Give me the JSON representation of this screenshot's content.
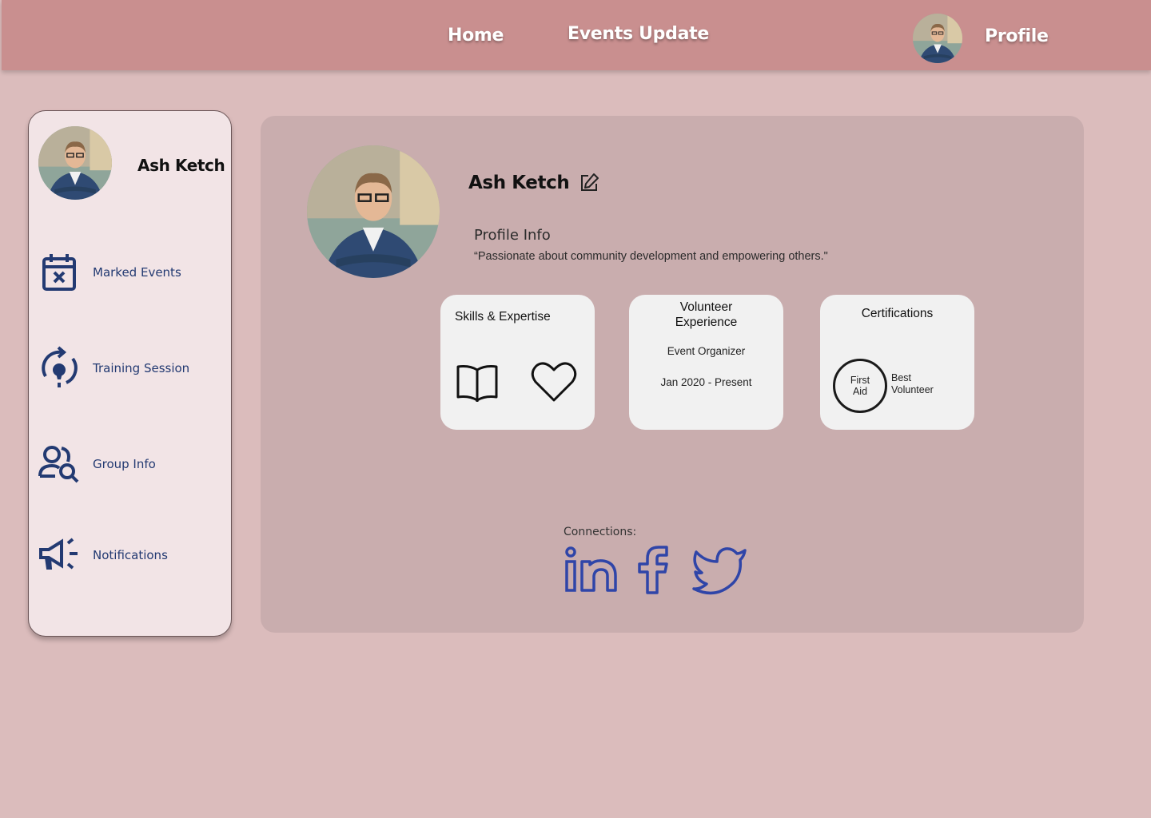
{
  "nav": {
    "home": "Home",
    "events_update": "Events Update",
    "profile": "Profile"
  },
  "user": {
    "name": "Ash Ketch"
  },
  "sidebar": {
    "items": [
      {
        "label": "Marked Events",
        "icon": "calendar-x-icon"
      },
      {
        "label": "Training Session",
        "icon": "lightbulb-refresh-icon"
      },
      {
        "label": "Group Info",
        "icon": "user-search-icon"
      },
      {
        "label": "Notifications",
        "icon": "megaphone-icon"
      }
    ]
  },
  "profile": {
    "info_title": "Profile Info",
    "bio": "“Passionate about community development and empowering others.\"",
    "skills": {
      "title": "Skills & Expertise",
      "icons": [
        "book-icon",
        "heart-icon"
      ]
    },
    "volunteer": {
      "title": "Volunteer Experience",
      "role": "Event Organizer",
      "dates": "Jan 2020 - Present"
    },
    "certifications": {
      "title": "Certifications",
      "badge": "First Aid",
      "item": "Best Volunteer"
    },
    "connections_label": "Connections:",
    "connections": [
      "linkedin-icon",
      "facebook-icon",
      "twitter-icon"
    ]
  },
  "colors": {
    "page_bg": "#dbbcbc",
    "topbar": "#c98f8f",
    "sidebar_bg": "#f2e4e6",
    "panel_bg": "#c9adae",
    "card_bg": "#f1f1f1",
    "sidebar_text": "#233a72",
    "social_icons": "#2f45a8"
  }
}
